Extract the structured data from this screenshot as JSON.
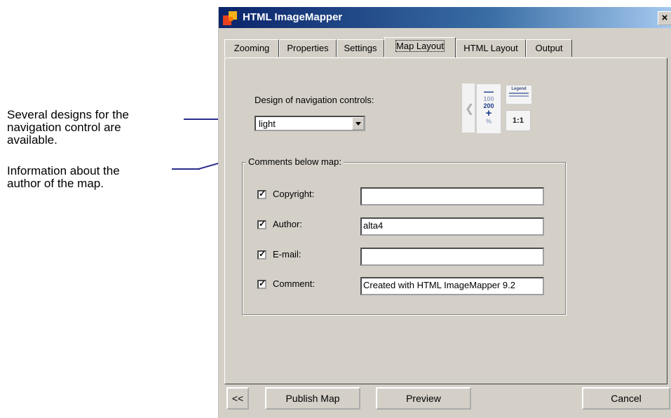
{
  "callouts": {
    "navigation_text": "Several designs for the navigation control are available.",
    "navigation_line1": "Several designs for the",
    "navigation_line2": "navigation control are",
    "navigation_line3": "available.",
    "author_line1": "Information about the",
    "author_line2": "author of the map."
  },
  "window": {
    "title": "HTML ImageMapper",
    "close_glyph": "×"
  },
  "tabs": [
    {
      "label": "Zooming"
    },
    {
      "label": "Properties"
    },
    {
      "label": "Settings"
    },
    {
      "label": "Map Layout"
    },
    {
      "label": "HTML Layout"
    },
    {
      "label": "Output"
    }
  ],
  "active_tab": "Map Layout",
  "design": {
    "label": "Design of navigation controls:",
    "selected": "light"
  },
  "preview": {
    "zoom_out": "—",
    "zoom_100": "100",
    "zoom_200": "200",
    "zoom_in": "+",
    "zoom_pct": "%",
    "legend_title": "Legend",
    "scale": "1:1"
  },
  "comments": {
    "group_label": "Comments below map:",
    "rows": [
      {
        "label": "Copyright:",
        "checked": true,
        "value": ""
      },
      {
        "label": "Author:",
        "checked": true,
        "value": "alta4"
      },
      {
        "label": "E-mail:",
        "checked": true,
        "value": ""
      },
      {
        "label": "Comment:",
        "checked": true,
        "value": "Created with HTML ImageMapper 9.2"
      }
    ]
  },
  "buttons": {
    "back": "<<",
    "publish": "Publish Map",
    "preview": "Preview",
    "cancel": "Cancel"
  },
  "colors": {
    "dialog_bg": "#d4d0c8",
    "titlebar_start": "#0a246a",
    "titlebar_end": "#a6caf0",
    "leader_line": "#2b2b8c"
  }
}
